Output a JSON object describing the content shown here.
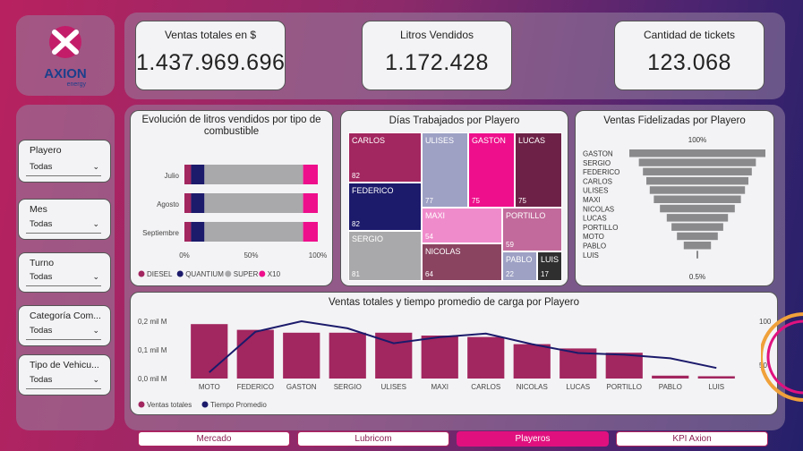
{
  "brand": {
    "logo_text": "AXION",
    "logo_sub": "energy"
  },
  "kpis": [
    {
      "title": "Ventas totales en $",
      "value": "1.437.969.696"
    },
    {
      "title": "Litros Vendidos",
      "value": "1.172.428"
    },
    {
      "title": "Cantidad de tickets",
      "value": "123.068"
    }
  ],
  "slicers": [
    {
      "label": "Playero",
      "value": "Todas"
    },
    {
      "label": "Mes",
      "value": "Todas"
    },
    {
      "label": "Turno",
      "value": "Todas"
    },
    {
      "label": "Categoría Com...",
      "value": "Todas"
    },
    {
      "label": "Tipo de Vehicu...",
      "value": "Todas"
    }
  ],
  "litros_chart": {
    "title": "Evolución de litros vendidos por tipo de combustible",
    "chart_data": {
      "type": "bar",
      "stacked": "100%",
      "categories": [
        "Julio",
        "Agosto",
        "Septiembre"
      ],
      "series": [
        {
          "name": "DIESEL",
          "color": "#a2265f",
          "values": [
            5,
            5,
            5
          ]
        },
        {
          "name": "QUANTIUM",
          "color": "#1b1a6b",
          "values": [
            10,
            10,
            10
          ]
        },
        {
          "name": "SUPER",
          "color": "#a9a9ab",
          "values": [
            74,
            74,
            74
          ]
        },
        {
          "name": "X10",
          "color": "#ee0f8c",
          "values": [
            11,
            11,
            11
          ]
        }
      ],
      "xticks": [
        "0%",
        "50%",
        "100%"
      ]
    }
  },
  "dias_chart": {
    "title": "Días Trabajados por Playero",
    "chart_data": {
      "type": "treemap",
      "items": [
        {
          "name": "CARLOS",
          "value": 82,
          "color": "#a2265f"
        },
        {
          "name": "FEDERICO",
          "value": 82,
          "color": "#1b1a6b"
        },
        {
          "name": "SERGIO",
          "value": 81,
          "color": "#a9a9ab"
        },
        {
          "name": "ULISES",
          "value": 77,
          "color": "#9ea1c4"
        },
        {
          "name": "GASTON",
          "value": 75,
          "color": "#ee0f8c"
        },
        {
          "name": "LUCAS",
          "value": 75,
          "color": "#6d2146"
        },
        {
          "name": "MAXI",
          "value": 54,
          "color": "#f08bcb"
        },
        {
          "name": "NICOLAS",
          "value": 64,
          "color": "#8a4460"
        },
        {
          "name": "PORTILLO",
          "value": 59,
          "color": "#c26a9b"
        },
        {
          "name": "PABLO",
          "value": 22,
          "color": "#9ea1c4"
        },
        {
          "name": "LUIS",
          "value": 17,
          "color": "#2f2f2f"
        }
      ]
    }
  },
  "fidel_chart": {
    "title": "Ventas Fidelizadas por Playero",
    "chart_data": {
      "type": "funnel",
      "categories": [
        "GASTON",
        "SERGIO",
        "FEDERICO",
        "CARLOS",
        "ULISES",
        "MAXI",
        "NICOLAS",
        "LUCAS",
        "PORTILLO",
        "MOTO",
        "PABLO",
        "LUIS"
      ],
      "values": [
        100,
        86,
        80,
        75,
        70,
        64,
        55,
        45,
        38,
        30,
        20,
        0.5
      ],
      "top_label": "100%",
      "bottom_label": "0.5%",
      "color": "#8a8a8c"
    }
  },
  "ventas_chart": {
    "title": "Ventas totales y tiempo promedio de carga por Playero",
    "chart_data": {
      "type": "bar",
      "categories": [
        "MOTO",
        "FEDERICO",
        "GASTON",
        "SERGIO",
        "ULISES",
        "MAXI",
        "CARLOS",
        "NICOLAS",
        "LUCAS",
        "PORTILLO",
        "PABLO",
        "LUIS"
      ],
      "series": [
        {
          "name": "Ventas totales",
          "type": "bar",
          "color": "#a2265f",
          "values": [
            0.19,
            0.17,
            0.16,
            0.16,
            0.16,
            0.15,
            0.145,
            0.12,
            0.105,
            0.09,
            0.01,
            0.008
          ]
        },
        {
          "name": "Tiempo Promedio",
          "type": "line",
          "color": "#1b1a6b",
          "values": [
            42,
            88,
            100,
            92,
            75,
            82,
            86,
            74,
            64,
            62,
            58,
            47
          ]
        }
      ],
      "yticks_left": [
        "0,0 mil M",
        "0,1 mil M",
        "0,2 mil M"
      ],
      "ylim_left": [
        0,
        0.2
      ],
      "yticks_right": [
        "50",
        "100"
      ],
      "ylim_right": [
        35,
        100
      ]
    }
  },
  "nav": [
    {
      "label": "Mercado",
      "active": false
    },
    {
      "label": "Lubricom",
      "active": false
    },
    {
      "label": "Playeros",
      "active": true
    },
    {
      "label": "KPI Axion",
      "active": false
    }
  ]
}
